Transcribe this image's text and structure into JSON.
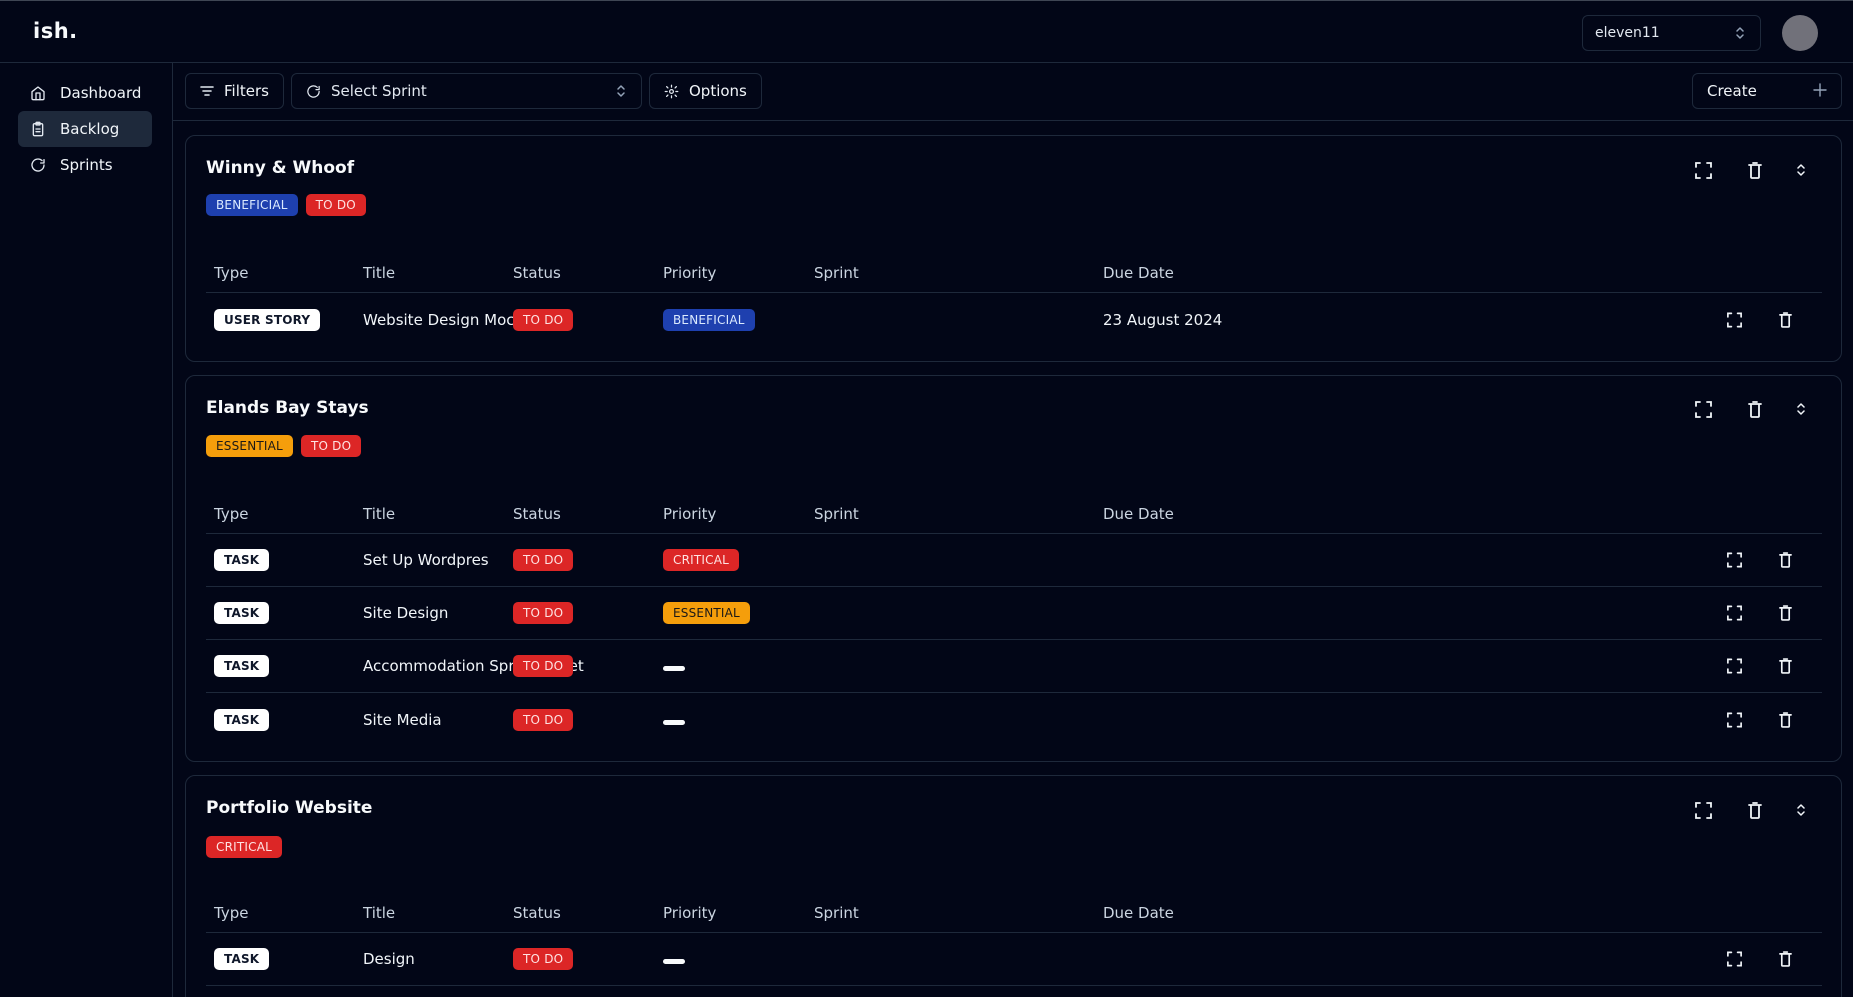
{
  "app": {
    "logo": "ish.",
    "account": "eleven11"
  },
  "sidebar": {
    "items": [
      {
        "label": "Dashboard",
        "icon": "home-icon",
        "active": false
      },
      {
        "label": "Backlog",
        "icon": "clipboard-icon",
        "active": true
      },
      {
        "label": "Sprints",
        "icon": "refresh-icon",
        "active": false
      }
    ]
  },
  "toolbar": {
    "filters_label": "Filters",
    "sprint_placeholder": "Select Sprint",
    "options_label": "Options",
    "create_label": "Create"
  },
  "columns": {
    "type": "Type",
    "title": "Title",
    "status": "Status",
    "priority": "Priority",
    "sprint": "Sprint",
    "due": "Due Date"
  },
  "colors": {
    "background": "#020617",
    "border": "#1e293b",
    "blue": "#1e40af",
    "red": "#dc2626",
    "amber": "#f59e0b"
  },
  "projects": [
    {
      "name": "Winny & Whoof",
      "tags": [
        {
          "label": "BENEFICIAL",
          "color": "blue"
        },
        {
          "label": "TO DO",
          "color": "red"
        }
      ],
      "rows": [
        {
          "type": "USER STORY",
          "title": "Website Design Mockup",
          "status": "TO DO",
          "priority": "BENEFICIAL",
          "sprint": "",
          "due": "23 August 2024"
        }
      ]
    },
    {
      "name": "Elands Bay Stays",
      "tags": [
        {
          "label": "ESSENTIAL",
          "color": "amber"
        },
        {
          "label": "TO DO",
          "color": "red"
        }
      ],
      "rows": [
        {
          "type": "TASK",
          "title": "Set Up Wordpres",
          "status": "TO DO",
          "priority": "CRITICAL",
          "sprint": "",
          "due": ""
        },
        {
          "type": "TASK",
          "title": "Site Design",
          "status": "TO DO",
          "priority": "ESSENTIAL",
          "sprint": "",
          "due": ""
        },
        {
          "type": "TASK",
          "title": "Accommodation Spreadsheet",
          "status": "TO DO",
          "priority": "",
          "sprint": "",
          "due": ""
        },
        {
          "type": "TASK",
          "title": "Site Media",
          "status": "TO DO",
          "priority": "",
          "sprint": "",
          "due": ""
        }
      ]
    },
    {
      "name": "Portfolio Website",
      "tags": [
        {
          "label": "CRITICAL",
          "color": "red"
        }
      ],
      "rows": [
        {
          "type": "TASK",
          "title": "Design",
          "status": "TO DO",
          "priority": "",
          "sprint": "",
          "due": ""
        }
      ]
    }
  ]
}
